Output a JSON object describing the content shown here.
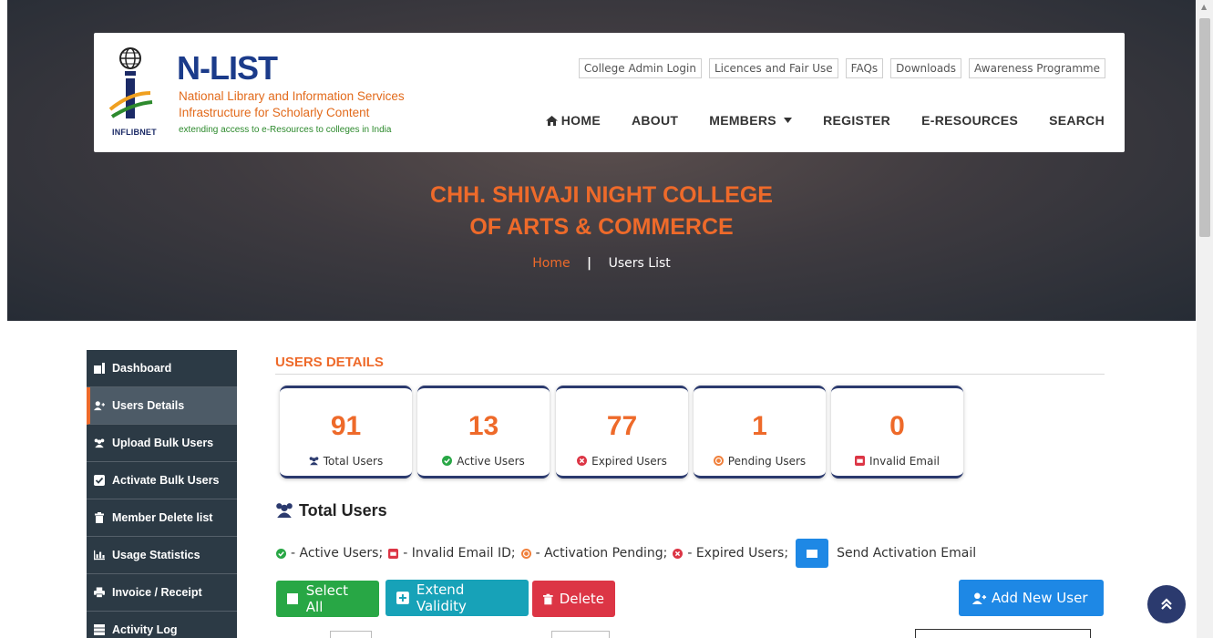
{
  "brand": {
    "title": "N-LIST",
    "line1": "National Library and Information Services",
    "line2": "Infrastructure for Scholarly Content",
    "line3": "extending access to e-Resources to colleges in India",
    "emblem_text": "INFLIBNET"
  },
  "top_links": [
    "College Admin Login",
    "Licences and Fair Use",
    "FAQs",
    "Downloads",
    "Awareness Programme"
  ],
  "main_nav": [
    {
      "label": "HOME",
      "icon": "home-icon"
    },
    {
      "label": "ABOUT"
    },
    {
      "label": "MEMBERS",
      "icon": "caret-down-icon"
    },
    {
      "label": "REGISTER"
    },
    {
      "label": "E-RESOURCES"
    },
    {
      "label": "SEARCH"
    }
  ],
  "hero": {
    "title_line1": "CHH. SHIVAJI NIGHT COLLEGE",
    "title_line2": "OF ARTS & COMMERCE",
    "breadcrumb_home": "Home",
    "breadcrumb_sep": "|",
    "breadcrumb_current": "Users List"
  },
  "sidebar": {
    "items": [
      {
        "label": "Dashboard",
        "icon": "dashboard-icon",
        "active": false
      },
      {
        "label": "Users Details",
        "icon": "user-plus-icon",
        "active": true
      },
      {
        "label": "Upload Bulk Users",
        "icon": "users-icon",
        "active": false
      },
      {
        "label": "Activate Bulk Users",
        "icon": "check-square-icon",
        "active": false
      },
      {
        "label": "Member Delete list",
        "icon": "trash-icon",
        "active": false
      },
      {
        "label": "Usage Statistics",
        "icon": "bar-chart-icon",
        "active": false
      },
      {
        "label": "Invoice / Receipt",
        "icon": "print-icon",
        "active": false
      },
      {
        "label": "Activity Log",
        "icon": "list-icon",
        "active": false
      }
    ]
  },
  "main": {
    "section_title": "USERS DETAILS",
    "stats": [
      {
        "value": "91",
        "label": "Total Users",
        "icon": "users-icon",
        "color": "#2b3a6e"
      },
      {
        "value": "13",
        "label": "Active Users",
        "icon": "check-circle-icon",
        "color": "#28a745"
      },
      {
        "value": "77",
        "label": "Expired Users",
        "icon": "times-circle-icon",
        "color": "#dc3545"
      },
      {
        "value": "1",
        "label": "Pending Users",
        "icon": "pending-icon",
        "color": "#f0803c"
      },
      {
        "value": "0",
        "label": "Invalid Email",
        "icon": "envelope-x-icon",
        "color": "#dc3545"
      }
    ],
    "list_heading": "Total Users",
    "legend": {
      "active": "- Active Users;",
      "invalid": "- Invalid Email ID;",
      "pending": "- Activation Pending;",
      "expired": "- Expired Users;",
      "send": "Send Activation Email"
    },
    "buttons": {
      "select_all": "Select All",
      "extend_validity": "Extend Validity",
      "delete": "Delete",
      "add_new_user": "Add New User"
    }
  },
  "fab_icon": "double-chevron-up-icon",
  "colors": {
    "accent": "#ee6a2a",
    "navy": "#2b3a6e",
    "sidebar_bg": "#2c3a45",
    "green": "#28a745",
    "teal": "#17a2b8",
    "red": "#dc3545",
    "blue": "#1e88e5"
  }
}
